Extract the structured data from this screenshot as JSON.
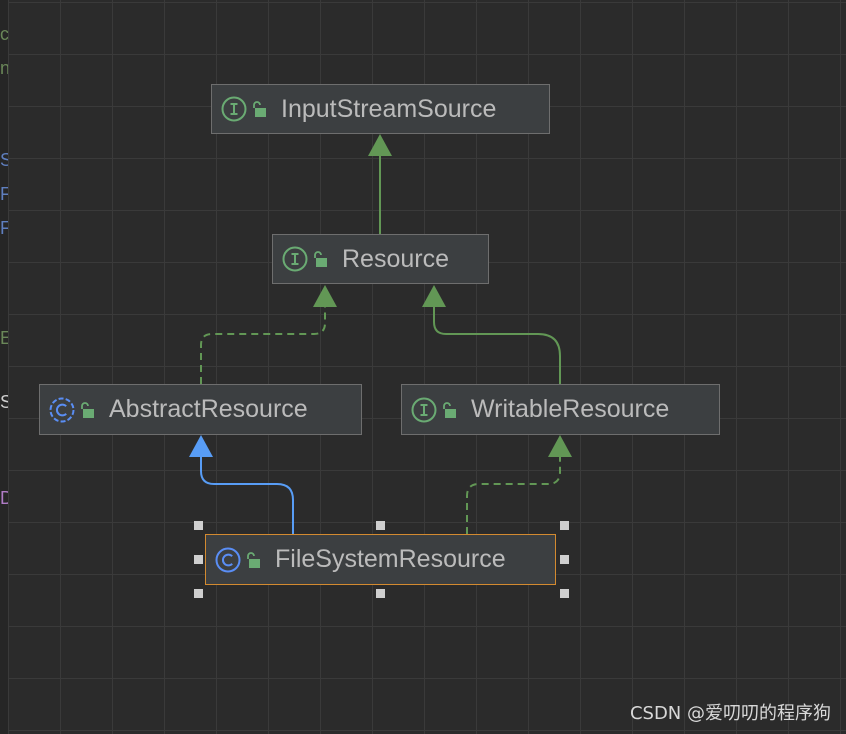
{
  "diagram": {
    "nodes": [
      {
        "id": "input-stream-source",
        "label": "InputStreamSource",
        "kind": "interface"
      },
      {
        "id": "resource",
        "label": "Resource",
        "kind": "interface"
      },
      {
        "id": "abstract-resource",
        "label": "AbstractResource",
        "kind": "class"
      },
      {
        "id": "writable-resource",
        "label": "WritableResource",
        "kind": "interface"
      },
      {
        "id": "file-system-resource",
        "label": "FileSystemResource",
        "kind": "class",
        "selected": true
      }
    ],
    "edges": [
      {
        "from": "resource",
        "to": "input-stream-source",
        "relation": "extends"
      },
      {
        "from": "abstract-resource",
        "to": "resource",
        "relation": "implements"
      },
      {
        "from": "writable-resource",
        "to": "resource",
        "relation": "extends"
      },
      {
        "from": "file-system-resource",
        "to": "abstract-resource",
        "relation": "extends"
      },
      {
        "from": "file-system-resource",
        "to": "writable-resource",
        "relation": "implements"
      }
    ],
    "icons": {
      "interface": "interface-icon",
      "class": "class-icon",
      "visibility": "unlocked-icon"
    }
  },
  "colors": {
    "interface_edge": "#629755",
    "class_edge": "#589df6",
    "interface_icon": "#6aab73",
    "class_icon": "#5a8ef5",
    "selection": "#d38a30"
  },
  "watermark": "CSDN @爱叨叨的程序狗"
}
